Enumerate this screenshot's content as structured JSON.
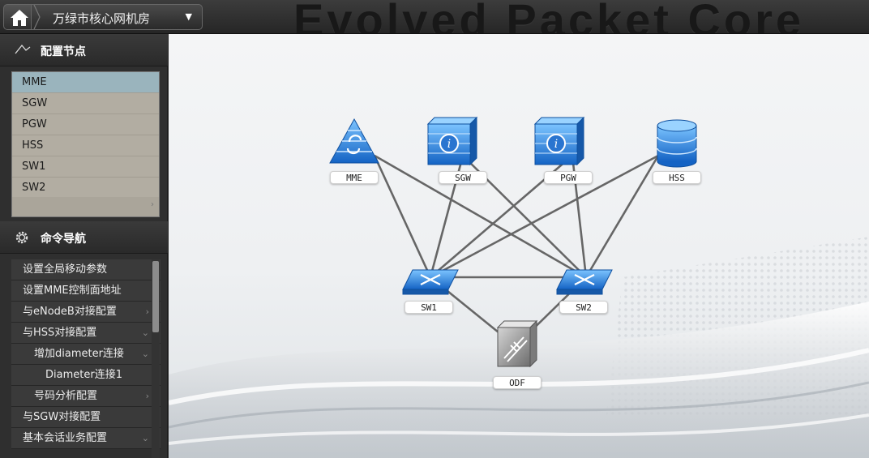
{
  "header": {
    "room_name": "万绿市核心网机房",
    "banner_text": "Evolved Packet Core",
    "home_icon": "home-icon",
    "caret_icon": "caret-down-icon"
  },
  "sidebar": {
    "config_nodes": {
      "title": "配置节点",
      "icon": "node-link-icon",
      "items": [
        {
          "label": "MME",
          "selected": true
        },
        {
          "label": "SGW"
        },
        {
          "label": "PGW"
        },
        {
          "label": "HSS"
        },
        {
          "label": "SW1"
        },
        {
          "label": "SW2"
        }
      ]
    },
    "command_nav": {
      "title": "命令导航",
      "icon": "gear-icon",
      "items": [
        {
          "label": "设置全局移动参数",
          "level": 0,
          "arrow": ""
        },
        {
          "label": "设置MME控制面地址",
          "level": 0,
          "arrow": ""
        },
        {
          "label": "与eNodeB对接配置",
          "level": 0,
          "arrow": "›"
        },
        {
          "label": "与HSS对接配置",
          "level": 0,
          "arrow": "⌄"
        },
        {
          "label": "增加diameter连接",
          "level": 1,
          "arrow": "⌄"
        },
        {
          "label": "Diameter连接1",
          "level": 2,
          "arrow": ""
        },
        {
          "label": "号码分析配置",
          "level": 1,
          "arrow": "›"
        },
        {
          "label": "与SGW对接配置",
          "level": 0,
          "arrow": ""
        },
        {
          "label": "基本会话业务配置",
          "level": 0,
          "arrow": "⌄"
        }
      ]
    }
  },
  "topology": {
    "nodes": [
      {
        "id": "MME",
        "label": "MME",
        "icon": "mme-pyramid-icon"
      },
      {
        "id": "SGW",
        "label": "SGW",
        "icon": "gateway-server-icon"
      },
      {
        "id": "PGW",
        "label": "PGW",
        "icon": "gateway-server-icon"
      },
      {
        "id": "HSS",
        "label": "HSS",
        "icon": "database-icon"
      },
      {
        "id": "SW1",
        "label": "SW1",
        "icon": "switch-icon"
      },
      {
        "id": "SW2",
        "label": "SW2",
        "icon": "switch-icon"
      },
      {
        "id": "ODF",
        "label": "ODF",
        "icon": "odf-icon"
      }
    ],
    "links": [
      [
        "MME",
        "SW1"
      ],
      [
        "MME",
        "SW2"
      ],
      [
        "SGW",
        "SW1"
      ],
      [
        "SGW",
        "SW2"
      ],
      [
        "PGW",
        "SW1"
      ],
      [
        "PGW",
        "SW2"
      ],
      [
        "HSS",
        "SW1"
      ],
      [
        "HSS",
        "SW2"
      ],
      [
        "SW1",
        "SW2"
      ],
      [
        "SW1",
        "ODF"
      ],
      [
        "SW2",
        "ODF"
      ]
    ],
    "colors": {
      "link": "#666666",
      "icon_blue": "#2f7fd6"
    }
  }
}
